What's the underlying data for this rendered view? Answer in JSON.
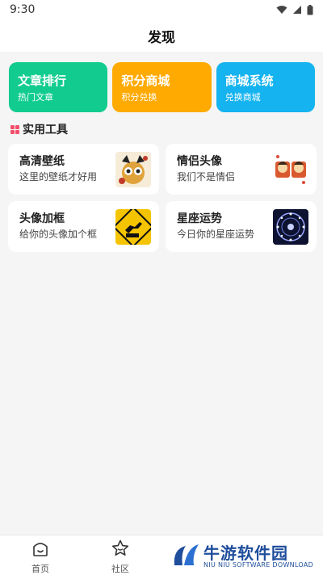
{
  "status_bar": {
    "time": "9:30"
  },
  "header": {
    "title": "发现"
  },
  "top_cards": [
    {
      "title": "文章排行",
      "subtitle": "热门文章",
      "color": "#11cc8e"
    },
    {
      "title": "积分商城",
      "subtitle": "积分兑换",
      "color": "#ffaa00"
    },
    {
      "title": "商城系统",
      "subtitle": "兑换商城",
      "color": "#15b3ef"
    }
  ],
  "section": {
    "title": "实用工具",
    "icon": "grid-icon",
    "icon_color": "#f2506a"
  },
  "tools": [
    {
      "title": "高清壁纸",
      "subtitle": "这里的壁纸才好用",
      "thumb": "wallpaper-thumbnail"
    },
    {
      "title": "情侣头像",
      "subtitle": "我们不是情侣",
      "thumb": "couple-avatar-thumbnail"
    },
    {
      "title": "头像加框",
      "subtitle": "给你的头像加个框",
      "thumb": "avatar-frame-thumbnail"
    },
    {
      "title": "星座运势",
      "subtitle": "今日你的星座运势",
      "thumb": "horoscope-thumbnail"
    }
  ],
  "bottom_nav": [
    {
      "label": "首页",
      "icon": "home-icon"
    },
    {
      "label": "社区",
      "icon": "star-icon"
    }
  ],
  "watermark": {
    "title": "牛游软件园",
    "subtitle": "NIU NIU SOFTWARE DOWNLOAD"
  }
}
